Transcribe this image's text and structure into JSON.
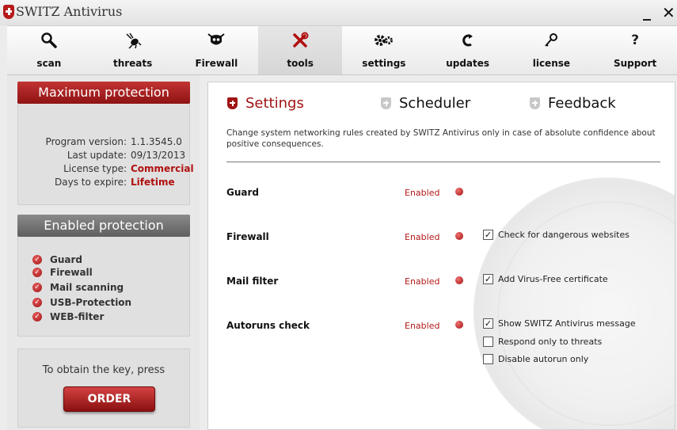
{
  "window": {
    "title": "SWITZ Antivirus",
    "minimize": "_",
    "close": "✕"
  },
  "toolbar": [
    {
      "label": "scan",
      "icon": "magnifier-icon"
    },
    {
      "label": "threats",
      "icon": "bug-icon"
    },
    {
      "label": "Firewall",
      "icon": "firewall-bug-icon"
    },
    {
      "label": "tools",
      "icon": "tools-icon",
      "active": true
    },
    {
      "label": "settings",
      "icon": "gears-icon"
    },
    {
      "label": "updates",
      "icon": "refresh-icon"
    },
    {
      "label": "license",
      "icon": "key-icon"
    },
    {
      "label": "Support",
      "icon": "question-icon"
    }
  ],
  "left": {
    "max_protection": {
      "header": "Maximum protection",
      "rows": [
        {
          "k": "Program version:",
          "v": "1.1.3545.0"
        },
        {
          "k": "Last update:",
          "v": "09/13/2013"
        },
        {
          "k": "License type:",
          "v": "Commercial"
        },
        {
          "k": "Days to expire:",
          "v": "Lifetime"
        }
      ]
    },
    "enabled_protection": {
      "header": "Enabled protection",
      "items": [
        "Guard",
        "Firewall",
        "Mail scanning",
        "USB-Protection",
        "WEB-filter"
      ]
    },
    "key": {
      "text": "To obtain the key, press",
      "button": "ORDER"
    }
  },
  "main": {
    "tabs": [
      "Settings",
      "Scheduler",
      "Feedback"
    ],
    "description": "Change system networking rules created by SWITZ Antivirus only in case of absolute confidence about positive consequences.",
    "settings": [
      {
        "label": "Guard",
        "status": "Enabled"
      },
      {
        "label": "Firewall",
        "status": "Enabled",
        "option": "Check for dangerous websites"
      },
      {
        "label": "Mail filter",
        "status": "Enabled",
        "option": "Add Virus-Free certificate"
      },
      {
        "label": "Autoruns check",
        "status": "Enabled",
        "options": [
          "Show SWITZ Antivirus message",
          "Respond only to threats",
          "Disable autorun only"
        ]
      }
    ],
    "checks": {
      "firewall": true,
      "mail": true,
      "autorun_message": true,
      "respond_threats": false,
      "disable_autorun": false
    }
  },
  "colors": {
    "accent": "#a01414",
    "header_red": "#b52828",
    "header_grey": "#707070"
  }
}
